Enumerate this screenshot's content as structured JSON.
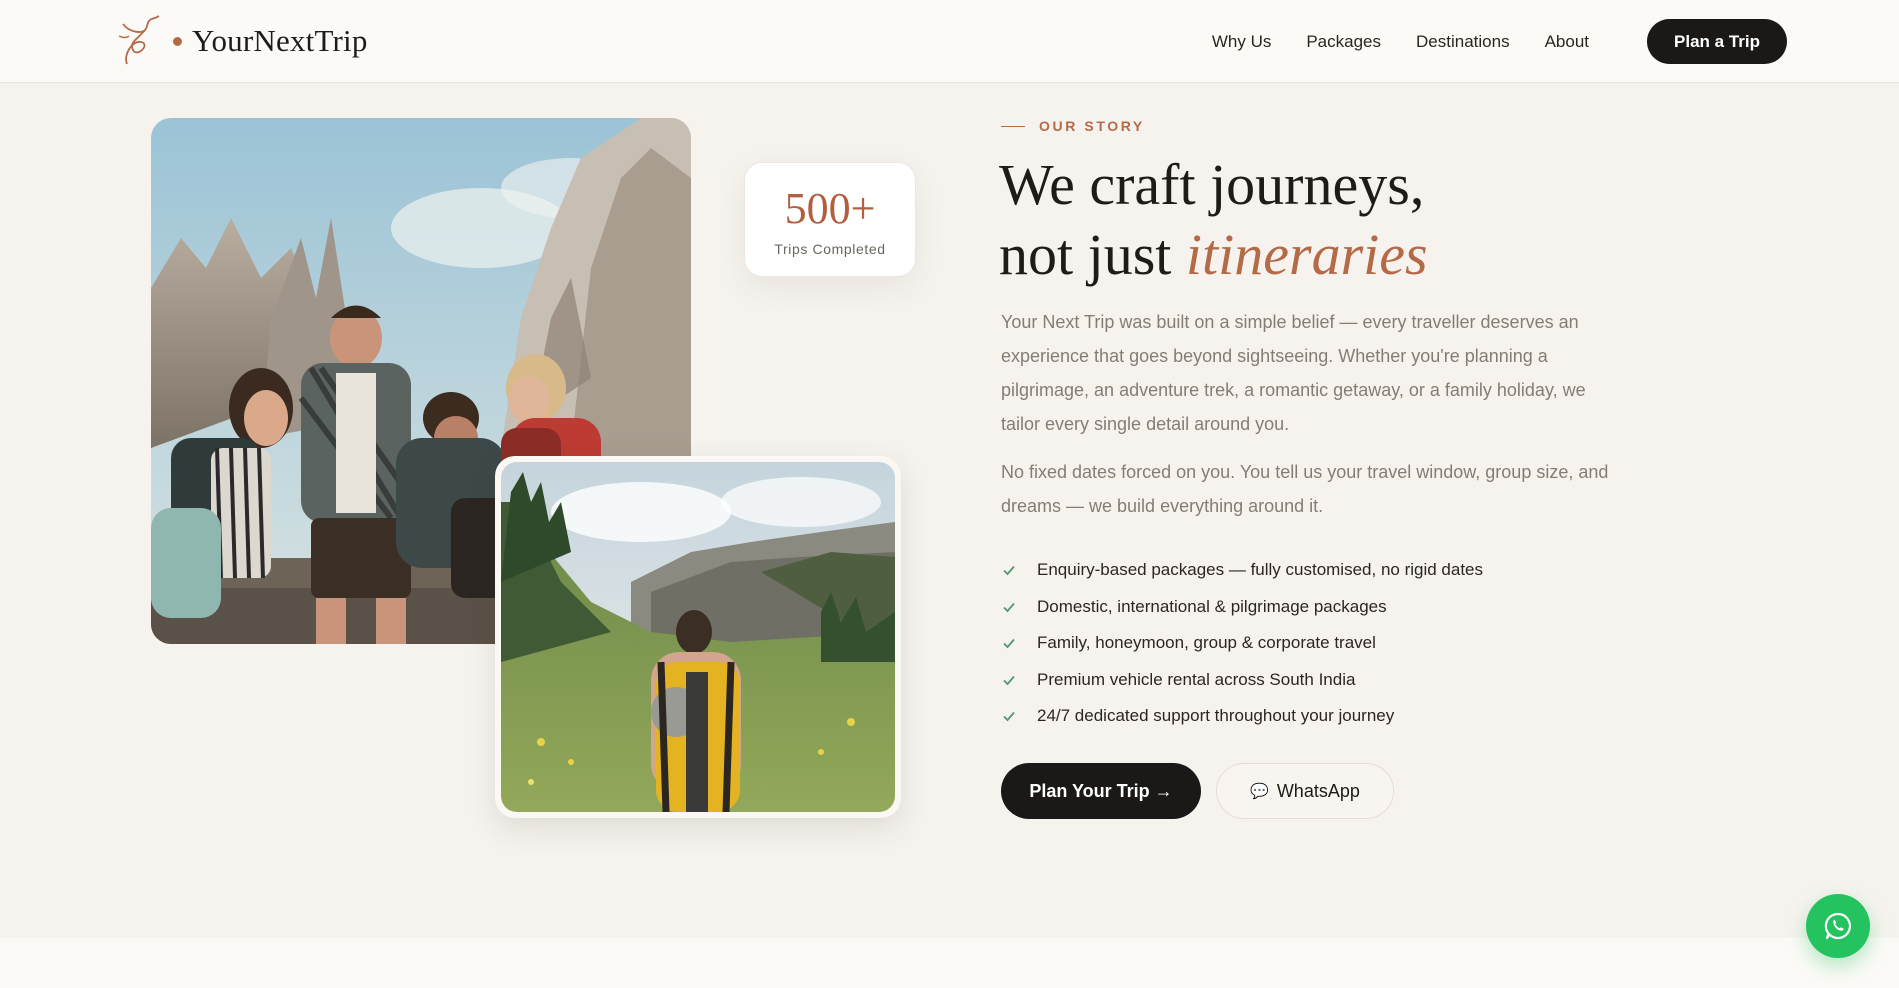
{
  "brand": {
    "name": "YourNextTrip",
    "logo_icon": "bird-trail-logo",
    "accent": "#b46a47"
  },
  "nav": {
    "links": [
      "Why Us",
      "Packages",
      "Destinations",
      "About"
    ],
    "cta_label": "Plan a Trip"
  },
  "stat": {
    "value": "500+",
    "label": "Trips Completed"
  },
  "story": {
    "eyebrow": "OUR STORY",
    "headline_line1": "We craft journeys,",
    "headline_line2_plain": "not just ",
    "headline_line2_accent": "itineraries",
    "paragraph1": "Your Next Trip was built on a simple belief — every traveller deserves an experience that goes beyond sightseeing. Whether you're planning a pilgrimage, an adventure trek, a romantic getaway, or a family holiday, we tailor every single detail around you.",
    "paragraph2": "No fixed dates forced on you. You tell us your travel window, group size, and dreams — we build everything around it.",
    "features": [
      "Enquiry-based packages — fully customised, no rigid dates",
      "Domestic, international & pilgrimage packages",
      "Family, honeymoon, group & corporate travel",
      "Premium vehicle rental across South India",
      "24/7 dedicated support throughout your journey"
    ],
    "primary_button": "Plan Your Trip →",
    "secondary_button": "WhatsApp",
    "secondary_button_icon": "speech-bubble-icon"
  },
  "images": {
    "main": "group-of-hikers-laughing-in-mountains",
    "inset": "hiker-with-yellow-backpack-in-green-valley"
  },
  "floating_button": {
    "icon": "whatsapp-icon",
    "color": "#25c35f"
  }
}
